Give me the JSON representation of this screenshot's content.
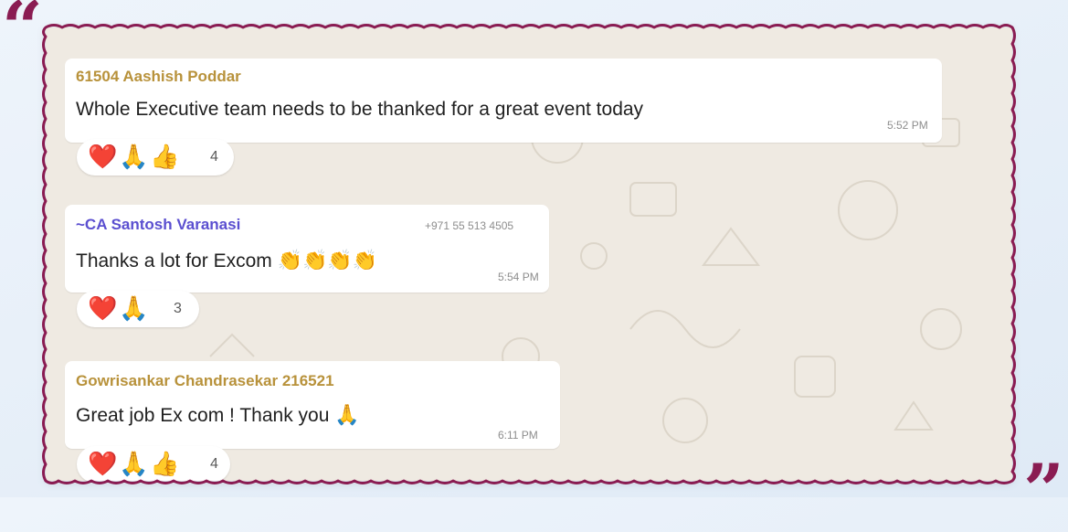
{
  "decor": {
    "quote_open": "“",
    "quote_close": "”",
    "border_color": "#8a1c52"
  },
  "messages": [
    {
      "sender": "61504 Aashish Poddar",
      "sender_color": "#b8923b",
      "text": "Whole Executive team needs to be thanked for a great event today",
      "time": "5:52 PM",
      "reactions": [
        "❤️",
        "🙏",
        "👍"
      ],
      "reaction_count": "4",
      "reaction_icons": [
        "heart-icon",
        "folded-hands-icon",
        "thumbs-up-icon"
      ]
    },
    {
      "sender": "~CA Santosh Varanasi",
      "sender_color": "#5b4fd0",
      "phone": "+971 55 513 4505",
      "text": "Thanks a lot for Excom",
      "text_emoji": "👏👏👏👏",
      "time": "5:54 PM",
      "reactions": [
        "❤️",
        "🙏"
      ],
      "reaction_count": "3",
      "reaction_icons": [
        "heart-icon",
        "folded-hands-icon"
      ]
    },
    {
      "sender": "Gowrisankar Chandrasekar 216521",
      "sender_color": "#b8923b",
      "text": "Great job Ex com ! Thank you",
      "text_emoji": "🙏",
      "time": "6:11 PM",
      "reactions": [
        "❤️",
        "🙏",
        "👍"
      ],
      "reaction_count": "4",
      "reaction_icons": [
        "heart-icon",
        "folded-hands-icon",
        "thumbs-up-icon"
      ]
    }
  ]
}
